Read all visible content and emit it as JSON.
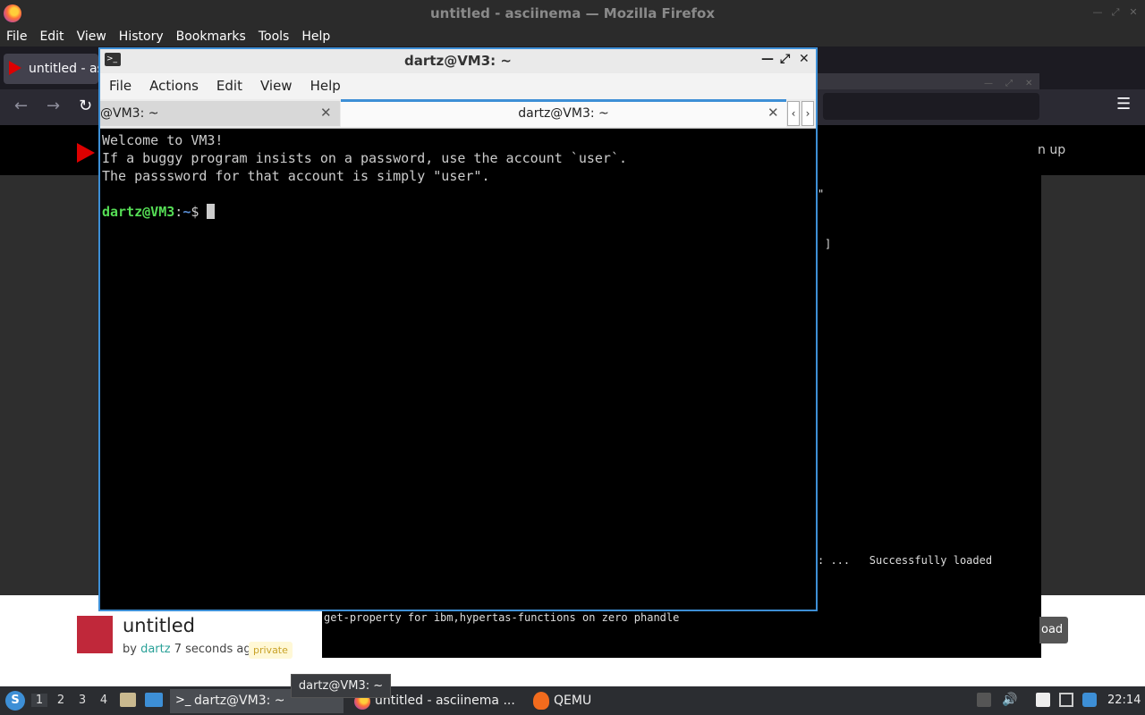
{
  "firefox": {
    "title": "untitled - asciinema — Mozilla Firefox",
    "menu": [
      "File",
      "Edit",
      "View",
      "History",
      "Bookmarks",
      "Tools",
      "Help"
    ],
    "tab_label": "untitled - asciinema",
    "hamburger": "☰"
  },
  "asciinema": {
    "signup_fragment": "n up",
    "player_lines": [
      "\"",
      "]",
      ": ...   Successfully loaded"
    ],
    "player_bottom_line": "get-property for ibm,hypertas-functions on zero phandle",
    "title": "untitled",
    "byline_prefix": "by",
    "user": "dartz",
    "time_ago": "7 seconds ago",
    "badge": "private",
    "download_fragment": "oad"
  },
  "terminal": {
    "title": "dartz@VM3: ~",
    "menu": [
      "File",
      "Actions",
      "Edit",
      "View",
      "Help"
    ],
    "tabs": [
      {
        "label": "@VM3: ~",
        "active": false
      },
      {
        "label": "dartz@VM3: ~",
        "active": true
      }
    ],
    "lines": [
      "Welcome to VM3!",
      "If a buggy program insists on a password, use the account `user`.",
      "The passsword for that account is simply \"user\"."
    ],
    "prompt_user": "dartz@VM3",
    "prompt_sep": ":",
    "prompt_path": "~",
    "prompt_sign": "$ "
  },
  "taskbar": {
    "workspaces": [
      "1",
      "2",
      "3",
      "4"
    ],
    "tasks": [
      {
        "label": "dartz@VM3: ~"
      },
      {
        "label": "untitled - asciinema ..."
      },
      {
        "label": "QEMU"
      }
    ],
    "tooltip": "dartz@VM3: ~",
    "clock": "22:14"
  }
}
